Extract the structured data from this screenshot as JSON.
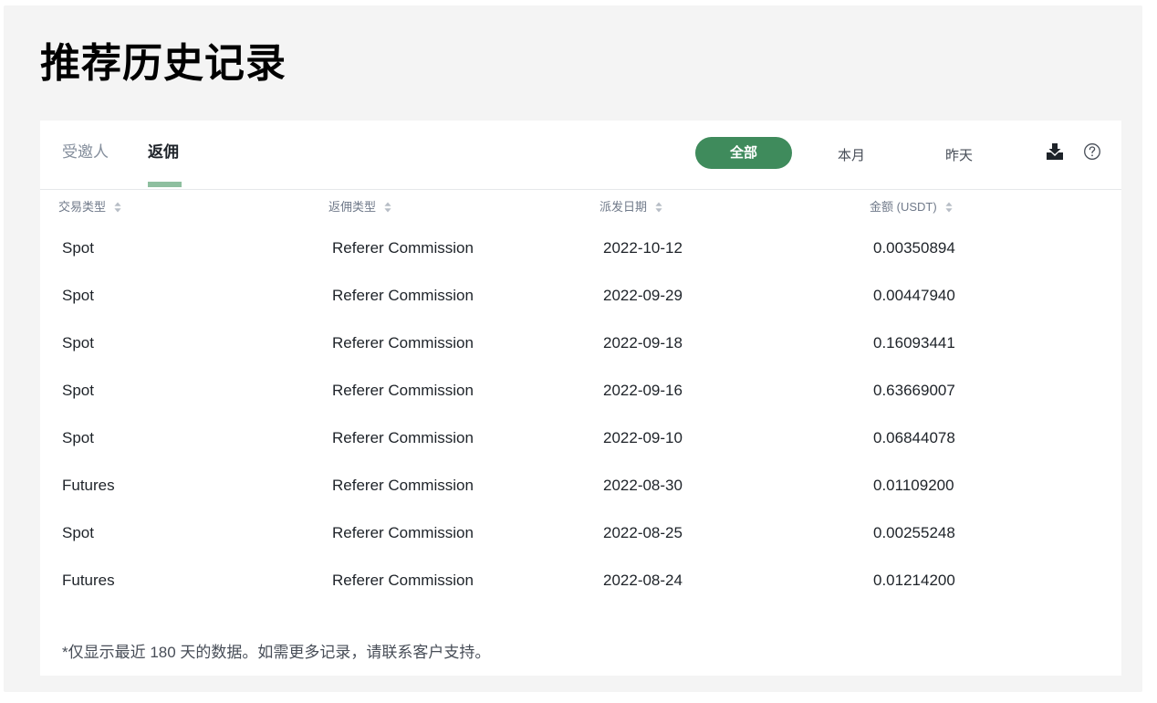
{
  "page": {
    "title": "推荐历史记录"
  },
  "tabs": [
    {
      "label": "受邀人",
      "active": false
    },
    {
      "label": "返佣",
      "active": true
    }
  ],
  "filters": {
    "all": "全部",
    "this_month": "本月",
    "yesterday": "昨天",
    "selected": "all"
  },
  "icons": {
    "download": "download-icon",
    "help": "help-icon"
  },
  "table": {
    "columns": [
      "交易类型",
      "返佣类型",
      "派发日期",
      "金额 (USDT)"
    ],
    "rows": [
      [
        "Spot",
        "Referer Commission",
        "2022-10-12",
        "0.00350894"
      ],
      [
        "Spot",
        "Referer Commission",
        "2022-09-29",
        "0.00447940"
      ],
      [
        "Spot",
        "Referer Commission",
        "2022-09-18",
        "0.16093441"
      ],
      [
        "Spot",
        "Referer Commission",
        "2022-09-16",
        "0.63669007"
      ],
      [
        "Spot",
        "Referer Commission",
        "2022-09-10",
        "0.06844078"
      ],
      [
        "Futures",
        "Referer Commission",
        "2022-08-30",
        "0.01109200"
      ],
      [
        "Spot",
        "Referer Commission",
        "2022-08-25",
        "0.00255248"
      ],
      [
        "Futures",
        "Referer Commission",
        "2022-08-24",
        "0.01214200"
      ]
    ]
  },
  "footnote": "*仅显示最近 180 天的数据。如需更多记录，请联系客户支持。",
  "colors": {
    "accent": "#3f8b5c",
    "tab_underline": "#8ebf9f",
    "panel_background": "#f4f4f4"
  }
}
